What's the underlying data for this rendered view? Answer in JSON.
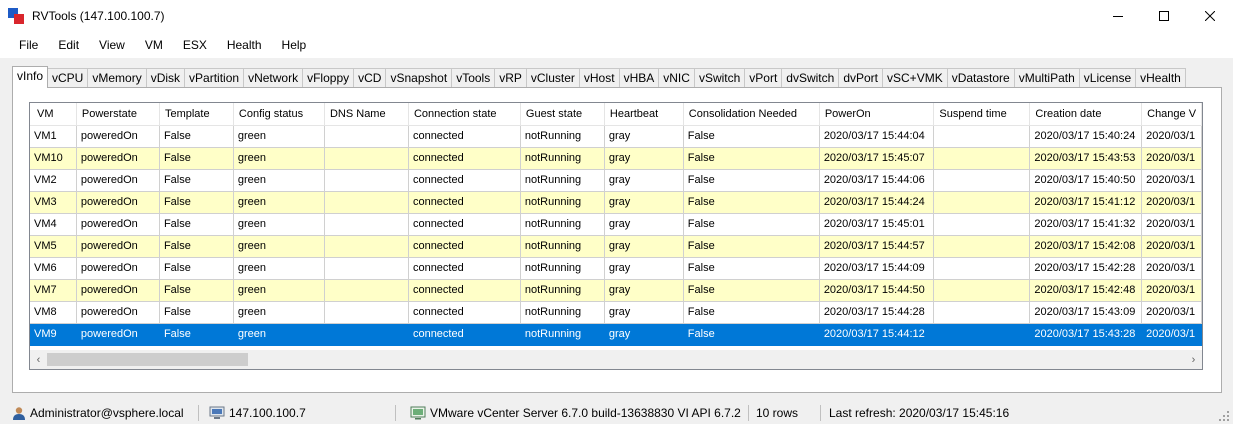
{
  "window": {
    "title": "RVTools (147.100.100.7)"
  },
  "menu": [
    "File",
    "Edit",
    "View",
    "VM",
    "ESX",
    "Health",
    "Help"
  ],
  "tabs": [
    "vInfo",
    "vCPU",
    "vMemory",
    "vDisk",
    "vPartition",
    "vNetwork",
    "vFloppy",
    "vCD",
    "vSnapshot",
    "vTools",
    "vRP",
    "vCluster",
    "vHost",
    "vHBA",
    "vNIC",
    "vSwitch",
    "vPort",
    "dvSwitch",
    "dvPort",
    "vSC+VMK",
    "vDatastore",
    "vMultiPath",
    "vLicense",
    "vHealth"
  ],
  "active_tab": "vInfo",
  "grid": {
    "columns": [
      "VM",
      "Powerstate",
      "Template",
      "Config status",
      "DNS Name",
      "Connection state",
      "Guest state",
      "Heartbeat",
      "Consolidation Needed",
      "PowerOn",
      "Suspend time",
      "Creation date",
      "Change V"
    ],
    "rows": [
      [
        "VM1",
        "poweredOn",
        "False",
        "green",
        "",
        "connected",
        "notRunning",
        "gray",
        "False",
        "2020/03/17 15:44:04",
        "",
        "2020/03/17 15:40:24",
        "2020/03/1"
      ],
      [
        "VM10",
        "poweredOn",
        "False",
        "green",
        "",
        "connected",
        "notRunning",
        "gray",
        "False",
        "2020/03/17 15:45:07",
        "",
        "2020/03/17 15:43:53",
        "2020/03/1"
      ],
      [
        "VM2",
        "poweredOn",
        "False",
        "green",
        "",
        "connected",
        "notRunning",
        "gray",
        "False",
        "2020/03/17 15:44:06",
        "",
        "2020/03/17 15:40:50",
        "2020/03/1"
      ],
      [
        "VM3",
        "poweredOn",
        "False",
        "green",
        "",
        "connected",
        "notRunning",
        "gray",
        "False",
        "2020/03/17 15:44:24",
        "",
        "2020/03/17 15:41:12",
        "2020/03/1"
      ],
      [
        "VM4",
        "poweredOn",
        "False",
        "green",
        "",
        "connected",
        "notRunning",
        "gray",
        "False",
        "2020/03/17 15:45:01",
        "",
        "2020/03/17 15:41:32",
        "2020/03/1"
      ],
      [
        "VM5",
        "poweredOn",
        "False",
        "green",
        "",
        "connected",
        "notRunning",
        "gray",
        "False",
        "2020/03/17 15:44:57",
        "",
        "2020/03/17 15:42:08",
        "2020/03/1"
      ],
      [
        "VM6",
        "poweredOn",
        "False",
        "green",
        "",
        "connected",
        "notRunning",
        "gray",
        "False",
        "2020/03/17 15:44:09",
        "",
        "2020/03/17 15:42:28",
        "2020/03/1"
      ],
      [
        "VM7",
        "poweredOn",
        "False",
        "green",
        "",
        "connected",
        "notRunning",
        "gray",
        "False",
        "2020/03/17 15:44:50",
        "",
        "2020/03/17 15:42:48",
        "2020/03/1"
      ],
      [
        "VM8",
        "poweredOn",
        "False",
        "green",
        "",
        "connected",
        "notRunning",
        "gray",
        "False",
        "2020/03/17 15:44:28",
        "",
        "2020/03/17 15:43:09",
        "2020/03/1"
      ],
      [
        "VM9",
        "poweredOn",
        "False",
        "green",
        "",
        "connected",
        "notRunning",
        "gray",
        "False",
        "2020/03/17 15:44:12",
        "",
        "2020/03/17 15:43:28",
        "2020/03/1"
      ]
    ],
    "selected_row": 9,
    "alt_row_color": "#ffffc8",
    "selection_color": "#0078d7"
  },
  "status": {
    "user": "Administrator@vsphere.local",
    "host": "147.100.100.7",
    "server": "VMware vCenter Server 6.7.0 build-13638830  VI API 6.7.2",
    "rows": "10 rows",
    "refresh": "Last refresh: 2020/03/17 15:45:16"
  }
}
